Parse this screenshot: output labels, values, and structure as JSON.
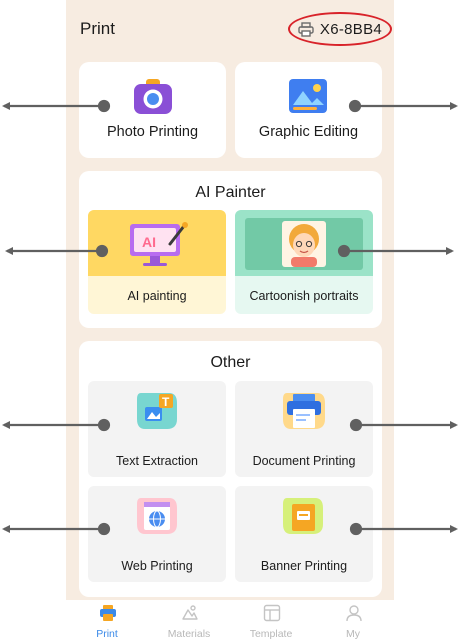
{
  "header": {
    "title": "Print",
    "device_name": "X6-8BB4"
  },
  "top_cards": [
    {
      "label": "Photo Printing",
      "icon": "camera-icon"
    },
    {
      "label": "Graphic Editing",
      "icon": "image-edit-icon"
    }
  ],
  "ai_painter": {
    "title": "AI Painter",
    "tiles": [
      {
        "label": "AI painting",
        "icon_text": "AI",
        "icon": "ai-monitor-icon"
      },
      {
        "label": "Cartoonish portraits",
        "icon": "cartoon-face-icon"
      }
    ]
  },
  "other": {
    "title": "Other",
    "tiles": [
      {
        "label": "Text Extraction",
        "icon": "text-extraction-icon",
        "icon_text": "T"
      },
      {
        "label": "Document Printing",
        "icon": "document-printer-icon"
      },
      {
        "label": "Web Printing",
        "icon": "web-globe-icon"
      },
      {
        "label": "Banner Printing",
        "icon": "banner-folder-icon"
      }
    ]
  },
  "tabbar": {
    "items": [
      {
        "label": "Print",
        "icon": "printer-tab-icon",
        "active": true
      },
      {
        "label": "Materials",
        "icon": "materials-tab-icon",
        "active": false
      },
      {
        "label": "Template",
        "icon": "template-tab-icon",
        "active": false
      },
      {
        "label": "My",
        "icon": "profile-tab-icon",
        "active": false
      }
    ]
  },
  "colors": {
    "background": "#f7ece1",
    "accent": "#3b8ae8",
    "highlight_ring": "#d8232a",
    "ai_tile": "#fff6d6",
    "cartoon_tile": "#e6f8f1",
    "arrow": "#606060"
  }
}
